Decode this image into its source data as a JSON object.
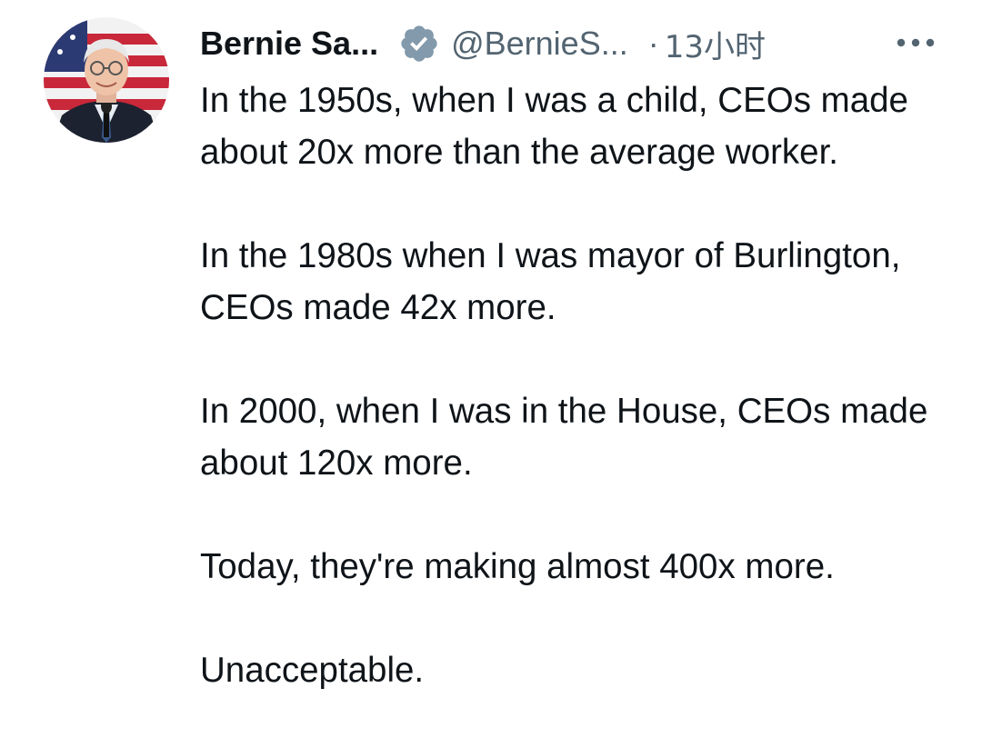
{
  "tweet": {
    "author": {
      "display_name": "Bernie Sa...",
      "handle": "@BernieS...",
      "verified": true,
      "avatar_icon": "avatar-photo"
    },
    "separator": "·",
    "timestamp": "13小时",
    "more_icon": "more-horizontal-icon",
    "paragraphs": [
      "In the 1950s, when I was a child, CEOs made about 20x more than the average worker.",
      "In the 1980s when I was mayor of Burlington, CEOs made 42x more.",
      "In 2000, when I was in the House, CEOs made about 120x more.",
      "Today, they're making almost 400x more.",
      "Unacceptable."
    ]
  },
  "colors": {
    "text_primary": "#0f1419",
    "text_secondary": "#536471",
    "verified_badge": "#829aab",
    "background": "#ffffff"
  }
}
